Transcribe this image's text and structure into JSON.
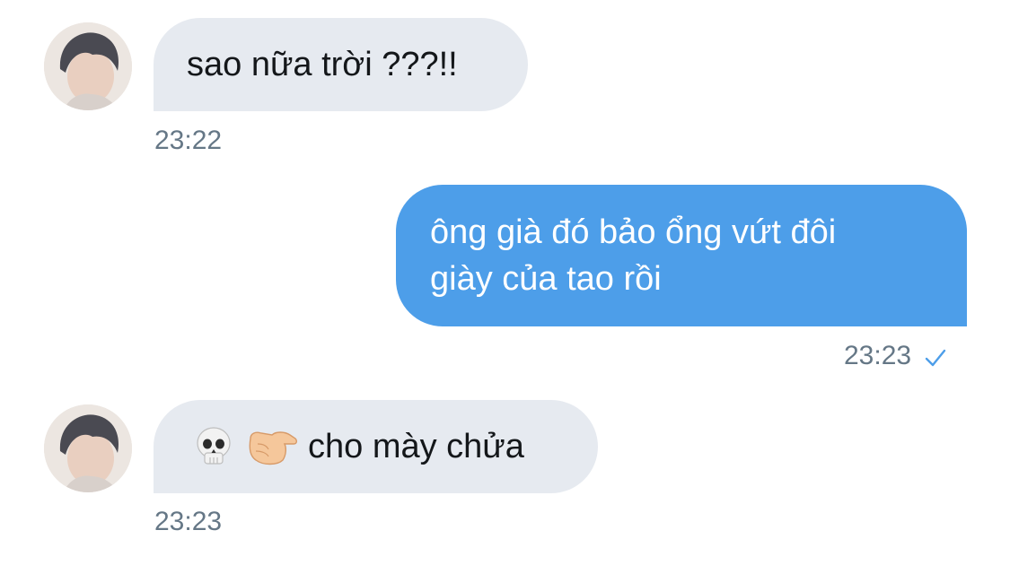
{
  "colors": {
    "incoming_bubble": "#e6eaf0",
    "outgoing_bubble": "#4d9ee9",
    "timestamp": "#657786",
    "read_check": "#4d9ee9"
  },
  "messages": [
    {
      "direction": "incoming",
      "text": "sao nữa trời ???!!",
      "time": "23:22",
      "avatar": "user-avatar"
    },
    {
      "direction": "outgoing",
      "line1": "ông già đó bảo ổng vứt đôi",
      "line2": "giày của tao rồi",
      "time": "23:23",
      "status_icon": "checkmark-icon"
    },
    {
      "direction": "incoming",
      "emojis": [
        "skull-emoji",
        "pointing-finger-emoji"
      ],
      "text": "cho mày chửa",
      "time": "23:23",
      "avatar": "user-avatar"
    }
  ]
}
